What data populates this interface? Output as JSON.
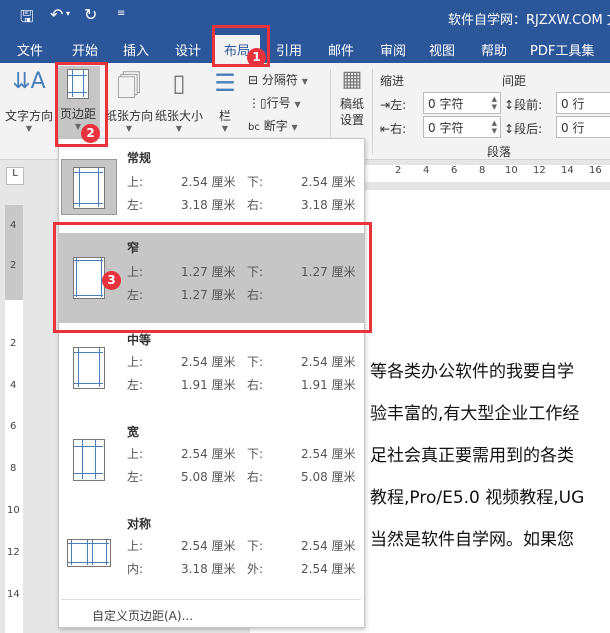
{
  "titlebar": {
    "title": "软件自学网：RJZXW.COM 文"
  },
  "tabs": [
    "文件",
    "开始",
    "插入",
    "设计",
    "布局",
    "引用",
    "邮件",
    "审阅",
    "视图",
    "帮助",
    "PDF工具集"
  ],
  "ribbon": {
    "text_direction": "文字方向",
    "margins": "页边距",
    "orientation": "纸张方向",
    "size": "纸张大小",
    "columns": "栏",
    "breaks": "分隔符",
    "line_numbers": "行号",
    "hyphenation": "断字",
    "manuscript": "稿纸\n设置",
    "indent_label": "缩进",
    "spacing_label": "间距",
    "left_label": "左:",
    "right_label": "右:",
    "before_label": "段前:",
    "after_label": "段后:",
    "left_value": "0 字符",
    "right_value": "0 字符",
    "before_value": "0 行",
    "after_value": "0 行",
    "paragraph_group": "段落"
  },
  "badges": [
    "1",
    "2",
    "3"
  ],
  "ruler": {
    "tab_selector": "L",
    "h_ticks": [
      "2",
      "4",
      "6",
      "8",
      "10",
      "12",
      "14",
      "16"
    ],
    "v_ticks": [
      "4",
      "2",
      "2",
      "4",
      "6",
      "8",
      "10",
      "12",
      "14"
    ]
  },
  "menu": {
    "options": [
      {
        "name": "常规",
        "l1": "上:",
        "v1": "2.54 厘米",
        "l2": "下:",
        "v2": "2.54 厘米",
        "l3": "左:",
        "v3": "3.18 厘米",
        "l4": "右:",
        "v4": "3.18 厘米"
      },
      {
        "name": "窄",
        "l1": "上:",
        "v1": "1.27 厘米",
        "l2": "下:",
        "v2": "1.27 厘米",
        "l3": "左:",
        "v3": "1.27 厘米",
        "l4": "右:",
        "v4": ""
      },
      {
        "name": "中等",
        "l1": "上:",
        "v1": "2.54 厘米",
        "l2": "下:",
        "v2": "2.54 厘米",
        "l3": "左:",
        "v3": "1.91 厘米",
        "l4": "右:",
        "v4": "1.91 厘米"
      },
      {
        "name": "宽",
        "l1": "上:",
        "v1": "2.54 厘米",
        "l2": "下:",
        "v2": "2.54 厘米",
        "l3": "左:",
        "v3": "5.08 厘米",
        "l4": "右:",
        "v4": "5.08 厘米"
      },
      {
        "name": "对称",
        "l1": "上:",
        "v1": "2.54 厘米",
        "l2": "下:",
        "v2": "2.54 厘米",
        "l3": "内:",
        "v3": "3.18 厘米",
        "l4": "外:",
        "v4": "2.54 厘米"
      }
    ],
    "custom": "自定义页边距(A)..."
  },
  "document": {
    "lines": [
      "等各类办公软件的我要自学",
      "验丰富的,有大型企业工作经",
      "足社会真正要需用到的各类",
      "教程,Pro/E5.0  视频教程,UG",
      "当然是软件自学网。如果您"
    ]
  }
}
